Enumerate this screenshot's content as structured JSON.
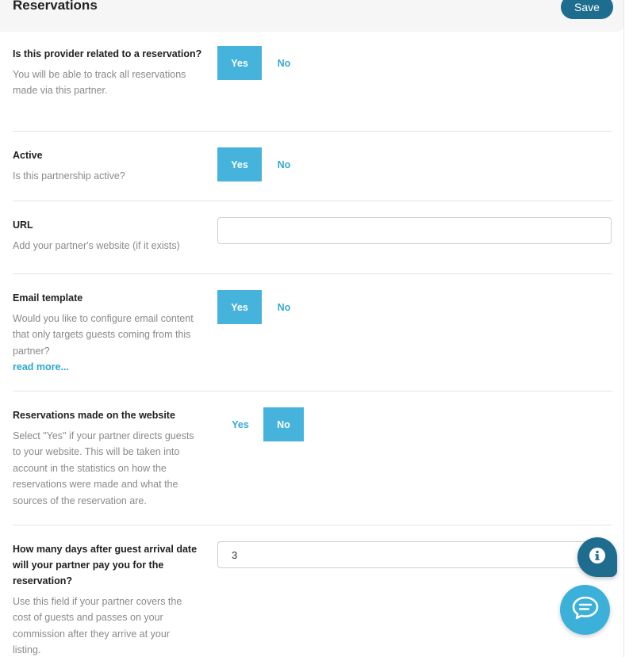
{
  "header": {
    "title": "Reservations",
    "save_label": "Save"
  },
  "toggle_labels": {
    "yes": "Yes",
    "no": "No"
  },
  "fields": {
    "related": {
      "label": "Is this provider related to a reservation?",
      "description": "You will be able to track all reservations made via this partner.",
      "value": "Yes"
    },
    "active": {
      "label": "Active",
      "description": "Is this partnership active?",
      "value": "Yes"
    },
    "url": {
      "label": "URL",
      "description": "Add your partner's website (if it exists)",
      "value": ""
    },
    "email_template": {
      "label": "Email template",
      "description": "Would you like to configure email content that only targets guests coming from this partner?",
      "read_more": "read more...",
      "value": "Yes"
    },
    "website_reservations": {
      "label": "Reservations made on the website",
      "description": "Select \"Yes\" if your partner directs guests to your website. This will be taken into account in the statistics on how the reservations were made and what the sources of the reservation are.",
      "value": "No"
    },
    "payment_days": {
      "label": "How many days after guest arrival date will your partner pay you for the reservation?",
      "description": "Use this field if your partner covers the cost of guests and passes on your commission after they arrive at your listing.",
      "value": "3"
    }
  },
  "icons": {
    "info": "info-icon",
    "chat": "chat-icon"
  },
  "colors": {
    "accent": "#46b3dc",
    "primary_dark": "#1e6d8f",
    "link": "#2ba6cf"
  }
}
